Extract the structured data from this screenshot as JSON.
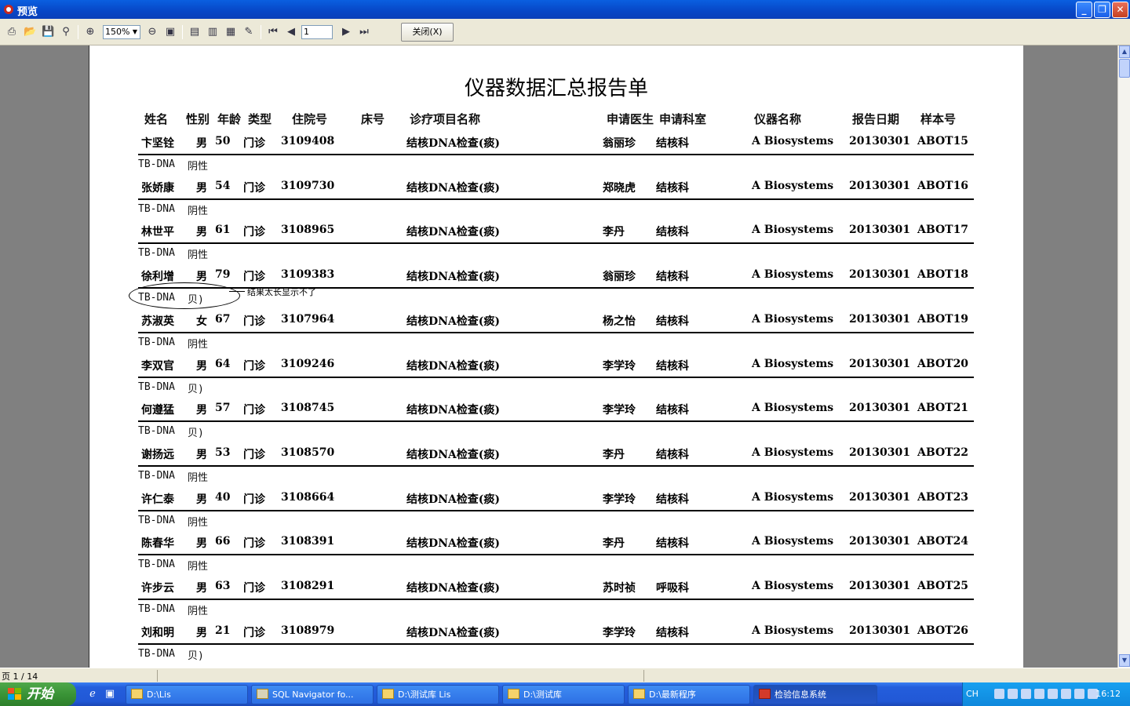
{
  "window": {
    "title": "预览"
  },
  "toolbar": {
    "zoom": "150%",
    "page_value": "1",
    "close_label": "关闭(X)"
  },
  "report": {
    "title": "仪器数据汇总报告单",
    "columns": [
      "姓名",
      "性别",
      "年龄",
      "类型",
      "住院号",
      "床号",
      "诊疗项目名称",
      "申请医生",
      "申请科室",
      "仪器名称",
      "报告日期",
      "样本号"
    ],
    "rows": [
      {
        "name": "卞坚铨",
        "sex": "男",
        "age": "50",
        "type": "门诊",
        "inpatient_no": "3109408",
        "item": "结核DNA检查(痰)",
        "doctor": "翁丽珍",
        "dept": "结核科",
        "instrument": "A Biosystems",
        "date": "20130301",
        "sample": "ABOT15",
        "result_code": "TB-DNA",
        "result_value": "阴性"
      },
      {
        "name": "张娇康",
        "sex": "男",
        "age": "54",
        "type": "门诊",
        "inpatient_no": "3109730",
        "item": "结核DNA检查(痰)",
        "doctor": "郑晓虎",
        "dept": "结核科",
        "instrument": "A Biosystems",
        "date": "20130301",
        "sample": "ABOT16",
        "result_code": "TB-DNA",
        "result_value": "阴性"
      },
      {
        "name": "林世平",
        "sex": "男",
        "age": "61",
        "type": "门诊",
        "inpatient_no": "3108965",
        "item": "结核DNA检查(痰)",
        "doctor": "李丹",
        "dept": "结核科",
        "instrument": "A Biosystems",
        "date": "20130301",
        "sample": "ABOT17",
        "result_code": "TB-DNA",
        "result_value": "阴性"
      },
      {
        "name": "徐利增",
        "sex": "男",
        "age": "79",
        "type": "门诊",
        "inpatient_no": "3109383",
        "item": "结核DNA检查(痰)",
        "doctor": "翁丽珍",
        "dept": "结核科",
        "instrument": "A Biosystems",
        "date": "20130301",
        "sample": "ABOT18",
        "result_code": "TB-DNA",
        "result_value": "贝)"
      },
      {
        "name": "苏淑英",
        "sex": "女",
        "age": "67",
        "type": "门诊",
        "inpatient_no": "3107964",
        "item": "结核DNA检查(痰)",
        "doctor": "杨之怡",
        "dept": "结核科",
        "instrument": "A Biosystems",
        "date": "20130301",
        "sample": "ABOT19",
        "result_code": "TB-DNA",
        "result_value": "阴性"
      },
      {
        "name": "李双官",
        "sex": "男",
        "age": "64",
        "type": "门诊",
        "inpatient_no": "3109246",
        "item": "结核DNA检查(痰)",
        "doctor": "李学玲",
        "dept": "结核科",
        "instrument": "A Biosystems",
        "date": "20130301",
        "sample": "ABOT20",
        "result_code": "TB-DNA",
        "result_value": "贝)"
      },
      {
        "name": "何遵猛",
        "sex": "男",
        "age": "57",
        "type": "门诊",
        "inpatient_no": "3108745",
        "item": "结核DNA检查(痰)",
        "doctor": "李学玲",
        "dept": "结核科",
        "instrument": "A Biosystems",
        "date": "20130301",
        "sample": "ABOT21",
        "result_code": "TB-DNA",
        "result_value": "贝)"
      },
      {
        "name": "谢扬远",
        "sex": "男",
        "age": "53",
        "type": "门诊",
        "inpatient_no": "3108570",
        "item": "结核DNA检查(痰)",
        "doctor": "李丹",
        "dept": "结核科",
        "instrument": "A Biosystems",
        "date": "20130301",
        "sample": "ABOT22",
        "result_code": "TB-DNA",
        "result_value": "阴性"
      },
      {
        "name": "许仁泰",
        "sex": "男",
        "age": "40",
        "type": "门诊",
        "inpatient_no": "3108664",
        "item": "结核DNA检查(痰)",
        "doctor": "李学玲",
        "dept": "结核科",
        "instrument": "A Biosystems",
        "date": "20130301",
        "sample": "ABOT23",
        "result_code": "TB-DNA",
        "result_value": "阴性"
      },
      {
        "name": "陈春华",
        "sex": "男",
        "age": "66",
        "type": "门诊",
        "inpatient_no": "3108391",
        "item": "结核DNA检查(痰)",
        "doctor": "李丹",
        "dept": "结核科",
        "instrument": "A Biosystems",
        "date": "20130301",
        "sample": "ABOT24",
        "result_code": "TB-DNA",
        "result_value": "阴性"
      },
      {
        "name": "许步云",
        "sex": "男",
        "age": "63",
        "type": "门诊",
        "inpatient_no": "3108291",
        "item": "结核DNA检查(痰)",
        "doctor": "苏时祯",
        "dept": "呼吸科",
        "instrument": "A Biosystems",
        "date": "20130301",
        "sample": "ABOT25",
        "result_code": "TB-DNA",
        "result_value": "阴性"
      },
      {
        "name": "刘和明",
        "sex": "男",
        "age": "21",
        "type": "门诊",
        "inpatient_no": "3108979",
        "item": "结核DNA检查(痰)",
        "doctor": "李学玲",
        "dept": "结核科",
        "instrument": "A Biosystems",
        "date": "20130301",
        "sample": "ABOT26",
        "result_code": "TB-DNA",
        "result_value": "贝)"
      }
    ],
    "annotation": "结果太长显示不了"
  },
  "statusbar": {
    "page_status": "页 1 / 14"
  },
  "taskbar": {
    "start_label": "开始",
    "tasks": [
      "D:\\Lis",
      "SQL Navigator fo...",
      "D:\\测试库 Lis",
      "D:\\测试库",
      "D:\\最新程序",
      "检验信息系统"
    ],
    "lang": "CH",
    "clock": "16:12"
  },
  "colors": {
    "titlebar": "#0a5fe0",
    "taskbar": "#245edc",
    "start": "#3a9437",
    "chrome": "#ece9d8"
  }
}
